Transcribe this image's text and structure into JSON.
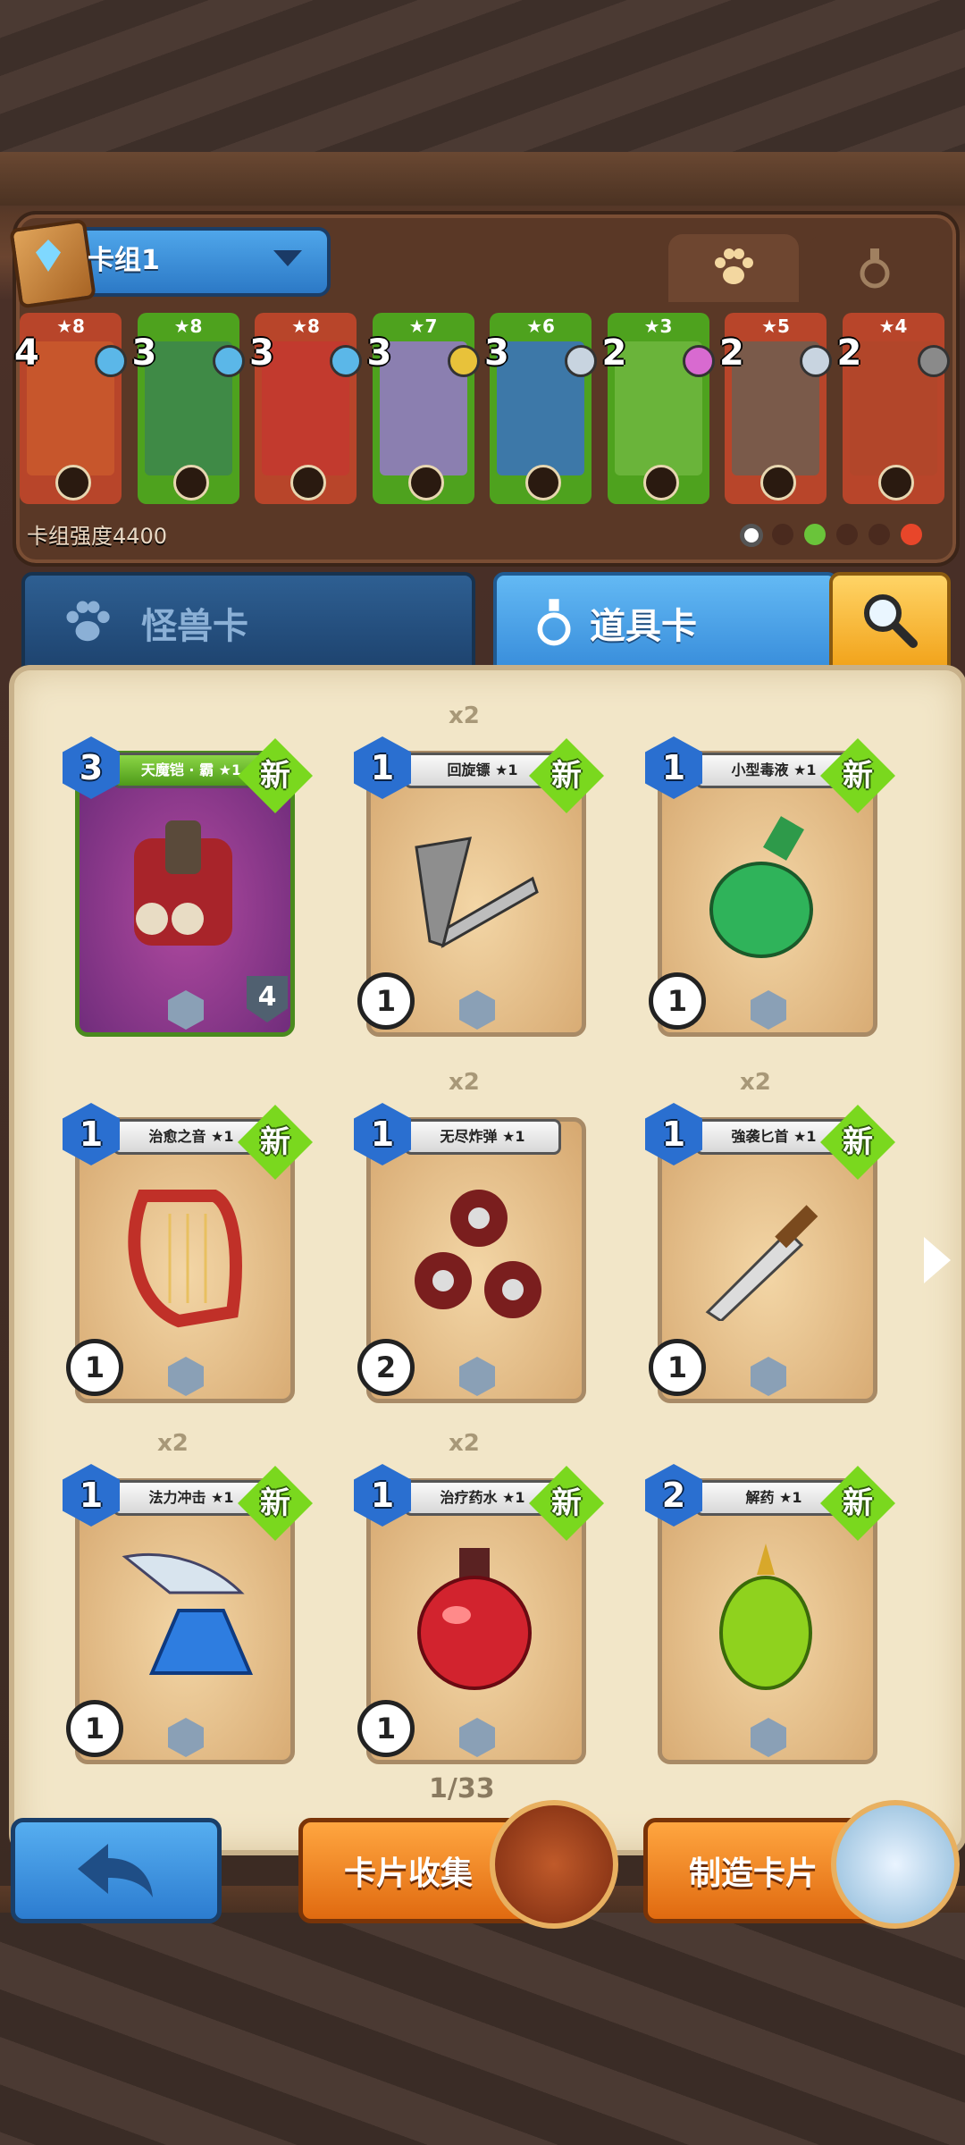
{
  "deck": {
    "name": "卡组1",
    "power_text": "卡组强度4400",
    "cards": [
      {
        "stars": "★8",
        "cost": "4",
        "header_color": "#b8452a",
        "art_color": "#c7562c",
        "gem_color": "#5bb7e8"
      },
      {
        "stars": "★8",
        "cost": "3",
        "header_color": "#4ea21e",
        "art_color": "#3f8a46",
        "gem_color": "#5bb7e8"
      },
      {
        "stars": "★8",
        "cost": "3",
        "header_color": "#b8452a",
        "art_color": "#c23a2e",
        "gem_color": "#5bb7e8"
      },
      {
        "stars": "★7",
        "cost": "3",
        "header_color": "#4ea21e",
        "art_color": "#8b7fb0",
        "gem_color": "#e8c23a"
      },
      {
        "stars": "★6",
        "cost": "3",
        "header_color": "#4ea21e",
        "art_color": "#3d78a8",
        "gem_color": "#c8d4e0"
      },
      {
        "stars": "★3",
        "cost": "2",
        "header_color": "#4ea21e",
        "art_color": "#6ab43a",
        "gem_color": "#d86ad0"
      },
      {
        "stars": "★5",
        "cost": "2",
        "header_color": "#b8452a",
        "art_color": "#7a5a4a",
        "gem_color": "#c8d4e0"
      },
      {
        "stars": "★4",
        "cost": "2",
        "header_color": "#b8452a",
        "art_color": "#b2462a",
        "gem_color": "#8a8a8a"
      }
    ]
  },
  "tabs": {
    "monster_tab_icon": "paw-icon",
    "item_tab_icon": "potion-icon"
  },
  "categories": {
    "monster_label": "怪兽卡",
    "item_label": "道具卡",
    "search_icon": "magnifier-icon"
  },
  "items": [
    {
      "name": "天魔铠 · 霸 ★1",
      "cost": "3",
      "count": "",
      "new": "新",
      "cooldown": "",
      "hp": "4",
      "art": "armor",
      "monster": true
    },
    {
      "name": "回旋镖 ★1",
      "cost": "1",
      "count": "x2",
      "new": "新",
      "cooldown": "1",
      "hp": "",
      "art": "boomerang",
      "monster": false
    },
    {
      "name": "小型毒液 ★1",
      "cost": "1",
      "count": "",
      "new": "新",
      "cooldown": "1",
      "hp": "",
      "art": "green-potion",
      "monster": false
    },
    {
      "name": "治愈之音 ★1",
      "cost": "1",
      "count": "",
      "new": "新",
      "cooldown": "1",
      "hp": "",
      "art": "harp",
      "monster": false
    },
    {
      "name": "无尽炸弹 ★1",
      "cost": "1",
      "count": "x2",
      "new": "",
      "cooldown": "2",
      "hp": "",
      "art": "bombs",
      "monster": false
    },
    {
      "name": "強袭匕首 ★1",
      "cost": "1",
      "count": "x2",
      "new": "新",
      "cooldown": "1",
      "hp": "",
      "art": "dagger",
      "monster": false
    },
    {
      "name": "法力冲击 ★1",
      "cost": "1",
      "count": "x2",
      "new": "新",
      "cooldown": "1",
      "hp": "",
      "art": "blue-potion",
      "monster": false
    },
    {
      "name": "治疗药水 ★1",
      "cost": "1",
      "count": "x2",
      "new": "新",
      "cooldown": "1",
      "hp": "",
      "art": "red-potion",
      "monster": false
    },
    {
      "name": "解药 ★1",
      "cost": "2",
      "count": "",
      "new": "新",
      "cooldown": "",
      "hp": "",
      "art": "antidote",
      "monster": false
    }
  ],
  "page": "1/33",
  "buttons": {
    "back_icon": "back-arrow-icon",
    "collection_label": "卡片收集",
    "craft_label": "制造卡片"
  }
}
